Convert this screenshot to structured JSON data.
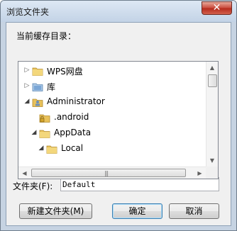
{
  "window": {
    "title": "浏览文件夹",
    "close_glyph": "✕"
  },
  "prompt": "当前缓存目录：",
  "tree": {
    "items": [
      {
        "label": "WPS网盘",
        "icon": "folder-icon",
        "state": "collapsed"
      },
      {
        "label": "库",
        "icon": "library-icon",
        "state": "collapsed"
      },
      {
        "label": "Administrator",
        "icon": "user-folder-icon",
        "state": "expanded"
      },
      {
        "label": ".android",
        "icon": "locked-folder-icon",
        "state": "none"
      },
      {
        "label": "AppData",
        "icon": "folder-icon",
        "state": "expanded"
      },
      {
        "label": "Local",
        "icon": "folder-icon",
        "state": "expanded"
      }
    ],
    "arrow_collapsed": "▷",
    "arrow_expanded": "◢",
    "scroll_up": "▲",
    "scroll_down": "▼",
    "scroll_left": "◀",
    "scroll_right": "▶",
    "grip": "|||"
  },
  "folder_field": {
    "label": "文件夹(F):",
    "value": "Default"
  },
  "buttons": {
    "new_folder": "新建文件夹(M)",
    "ok": "确定",
    "cancel": "取消"
  }
}
